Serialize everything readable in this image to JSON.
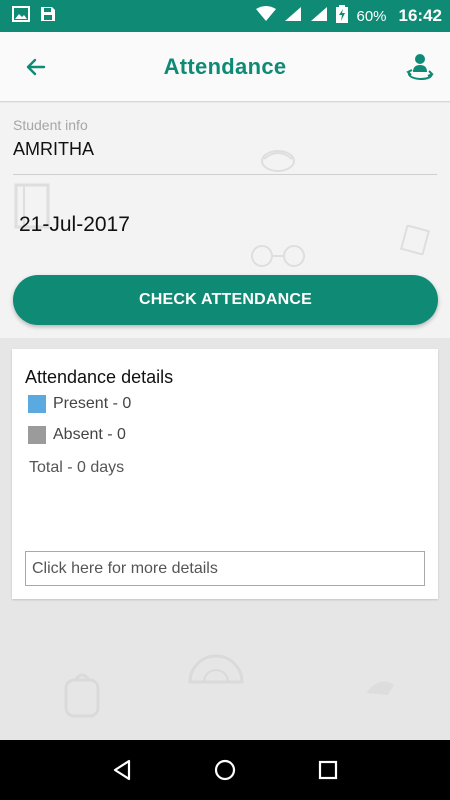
{
  "status_bar": {
    "battery": "60%",
    "time": "16:42",
    "icons": [
      "image-icon",
      "save-icon",
      "wifi-icon",
      "signal-icon",
      "signal-icon",
      "battery-charging-icon"
    ]
  },
  "app_bar": {
    "title": "Attendance",
    "back_icon": "arrow-left-icon",
    "profile_icon": "switch-user-icon"
  },
  "student": {
    "label": "Student info",
    "name": "AMRITHA"
  },
  "date": "21-Jul-2017",
  "check_button": "CHECK ATTENDANCE",
  "details": {
    "title": "Attendance details",
    "present": "Present - 0",
    "absent": "Absent - 0",
    "total": "Total - 0 days",
    "more_placeholder": "Click here for more details"
  },
  "colors": {
    "accent": "#0f8a74",
    "present": "#5aa9e0",
    "absent": "#9b9b9b"
  },
  "nav": {
    "back_icon": "triangle-back-icon",
    "home_icon": "circle-home-icon",
    "recents_icon": "square-recents-icon"
  }
}
